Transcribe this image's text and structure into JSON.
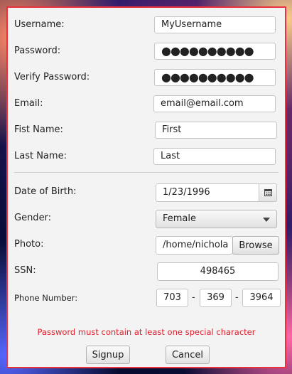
{
  "form": {
    "username": {
      "label": "Username:",
      "value": "MyUsername"
    },
    "password": {
      "label": "Password:",
      "value": "●●●●●●●●●●"
    },
    "verify_password": {
      "label": "Verify Password:",
      "value": "●●●●●●●●●●"
    },
    "email": {
      "label": "Email:",
      "value": "email@email.com"
    },
    "first_name": {
      "label": "Fist Name:",
      "value": "First"
    },
    "last_name": {
      "label": "Last Name:",
      "value": "Last"
    },
    "dob": {
      "label": "Date of Birth:",
      "value": "1/23/1996"
    },
    "gender": {
      "label": "Gender:",
      "value": "Female"
    },
    "photo": {
      "label": "Photo:",
      "value": "/home/nichola",
      "browse_label": "Browse"
    },
    "ssn": {
      "label": "SSN:",
      "value": "498465"
    },
    "phone": {
      "label": "Phone Number:",
      "part1": "703",
      "part2": "369",
      "part3": "3964",
      "sep1": "-",
      "sep2": "-"
    },
    "error_message": "Password must contain at least one special character",
    "signup_label": "Signup",
    "cancel_label": "Cancel"
  },
  "colors": {
    "border": "#e8323c",
    "error": "#e0202a",
    "panel": "#f3f3f3"
  },
  "icons": {
    "date_picker": "calendar-icon",
    "dropdown": "chevron-down-icon"
  }
}
